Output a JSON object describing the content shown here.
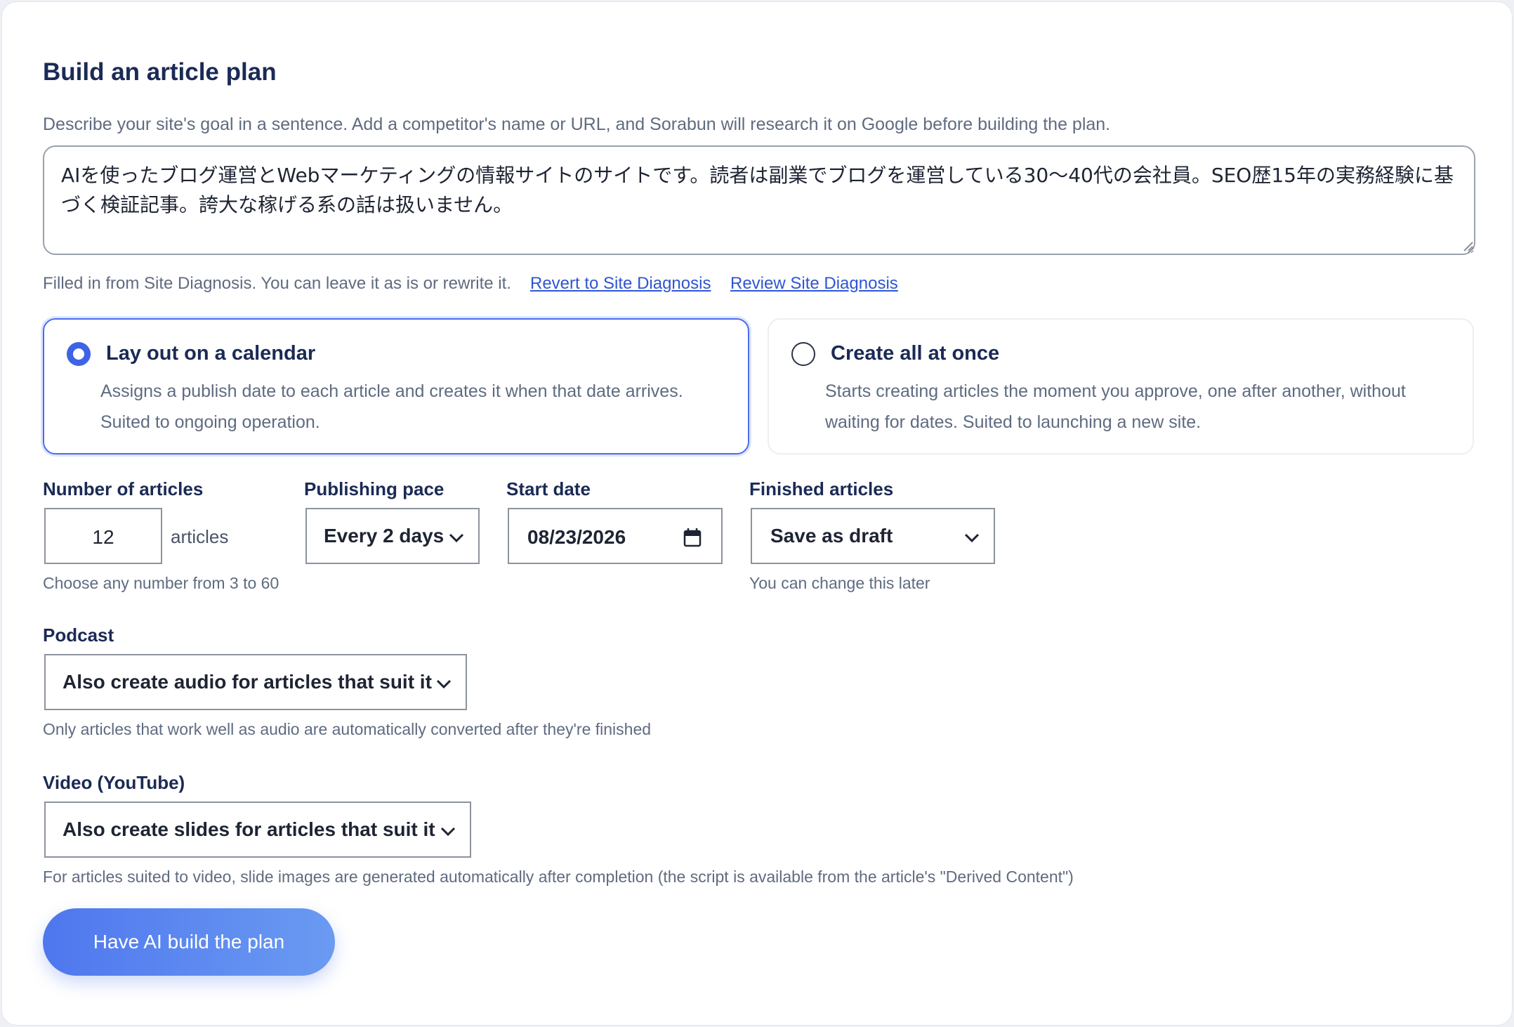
{
  "form": {
    "title": "Build an article plan",
    "description": "Describe your site's goal in a sentence. Add a competitor's name or URL, and Sorabun will research it on Google before building the plan.",
    "goal_value": "AIを使ったブログ運営とWebマーケティングの情報サイトのサイトです。読者は副業でブログを運営している30〜40代の会社員。SEO歴15年の実務経験に基づく検証記事。誇大な稼げる系の話は扱いません。",
    "hint": "Filled in from Site Diagnosis. You can leave it as is or rewrite it.",
    "revert_link": "Revert to Site Diagnosis",
    "review_link": "Review Site Diagnosis"
  },
  "modes": [
    {
      "title": "Lay out on a calendar",
      "description": "Assigns a publish date to each article and creates it when that date arrives. Suited to ongoing operation.",
      "selected": true
    },
    {
      "title": "Create all at once",
      "description": "Starts creating articles the moment you approve, one after another, without waiting for dates. Suited to launching a new site.",
      "selected": false
    }
  ],
  "settings": {
    "count_label": "Number of articles",
    "count_value": "12",
    "count_unit": "articles",
    "count_help": "Choose any number from 3 to 60",
    "pace_label": "Publishing pace",
    "pace_value": "Every 2 days",
    "start_label": "Start date",
    "start_value": "08/23/2026",
    "finished_label": "Finished articles",
    "finished_value": "Save as draft",
    "finished_help": "You can change this later"
  },
  "podcast": {
    "label": "Podcast",
    "value": "Also create audio for articles that suit it",
    "help": "Only articles that work well as audio are automatically converted after they're finished"
  },
  "video": {
    "label": "Video (YouTube)",
    "value": "Also create slides for articles that suit it",
    "help": "For articles suited to video, slide images are generated automatically after completion (the script is available from the article's \"Derived Content\")"
  },
  "submit_label": "Have AI build the plan",
  "colors": {
    "accent": "#3f63e6",
    "heading": "#1b2a55",
    "muted": "#5f6b80",
    "link": "#2f55d4"
  }
}
